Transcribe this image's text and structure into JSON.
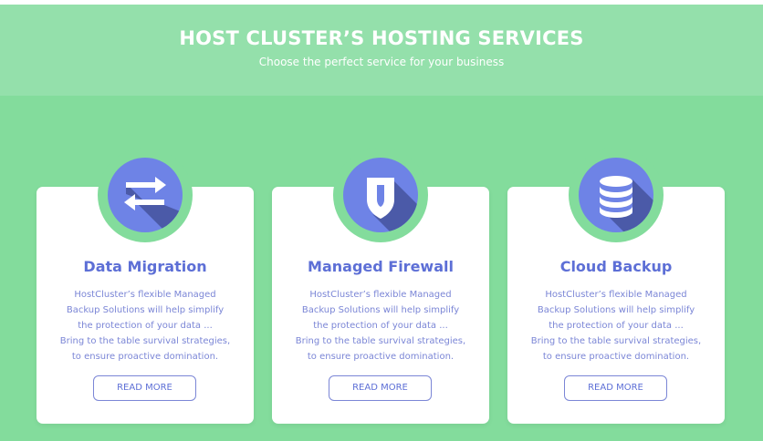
{
  "header": {
    "title": "HOST CLUSTER’S HOSTING SERVICES",
    "subtitle": "Choose the perfect service for your business"
  },
  "colors": {
    "background": "#83dc9c",
    "header_band": "#94e0ab",
    "icon_circle": "#6e83e6",
    "accent": "#5d6fd6"
  },
  "cards": [
    {
      "icon": "transfer-arrows-icon",
      "title": "Data Migration",
      "lines": [
        "HostCluster’s flexible Managed",
        "Backup Solutions will help simplify",
        "the protection of your data ...",
        "Bring to the table survival strategies,",
        "to ensure proactive domination."
      ],
      "button": "READ MORE"
    },
    {
      "icon": "shield-icon",
      "title": "Managed Firewall",
      "lines": [
        "HostCluster’s flexible Managed",
        "Backup Solutions will help simplify",
        "the protection of your data ...",
        "Bring to the table survival strategies,",
        "to ensure proactive domination."
      ],
      "button": "READ MORE"
    },
    {
      "icon": "database-icon",
      "title": "Cloud Backup",
      "lines": [
        "HostCluster’s flexible Managed",
        "Backup Solutions will help simplify",
        "the protection of your data ...",
        "Bring to the table survival strategies,",
        "to ensure proactive domination."
      ],
      "button": "READ MORE"
    }
  ]
}
